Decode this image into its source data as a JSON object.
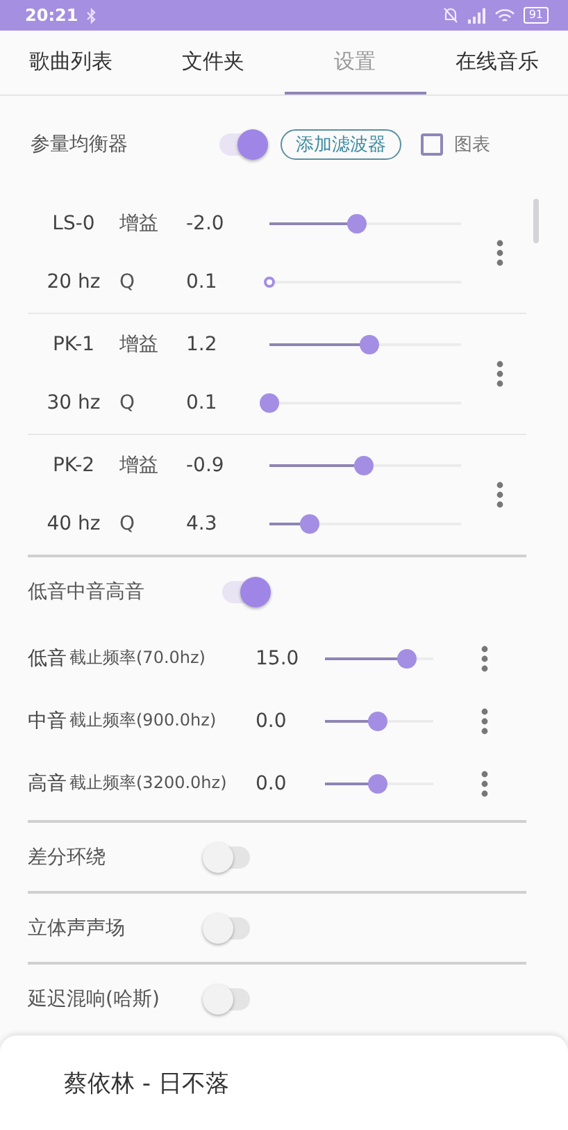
{
  "status_bar": {
    "time": "20:21",
    "battery": "91"
  },
  "tabs": [
    {
      "label": "歌曲列表",
      "selected": false
    },
    {
      "label": "文件夹",
      "selected": false
    },
    {
      "label": "设置",
      "selected": true
    },
    {
      "label": "在线音乐",
      "selected": false
    }
  ],
  "equalizer": {
    "title": "参量均衡器",
    "on": true,
    "add_button": "添加滤波器",
    "chart_label": "图表",
    "chart_checked": false,
    "filters": [
      {
        "name": "LS-0",
        "freq": "20 hz",
        "params": [
          {
            "label": "增益",
            "value": "-2.0",
            "level": 0.46,
            "disabled": false
          },
          {
            "label": "Q",
            "value": "0.1",
            "level": 0,
            "disabled": true
          }
        ]
      },
      {
        "name": "PK-1",
        "freq": "30 hz",
        "params": [
          {
            "label": "增益",
            "value": "1.2",
            "level": 0.52,
            "disabled": false
          },
          {
            "label": "Q",
            "value": "0.1",
            "level": 0,
            "disabled": false
          }
        ]
      },
      {
        "name": "PK-2",
        "freq": "40 hz",
        "params": [
          {
            "label": "增益",
            "value": "-0.9",
            "level": 0.49,
            "disabled": false
          },
          {
            "label": "Q",
            "value": "4.3",
            "level": 0.21,
            "disabled": false
          }
        ]
      }
    ]
  },
  "tone": {
    "title": "低音中音高音",
    "on": true,
    "bands": [
      {
        "name": "低音",
        "cutoff": "截止频率(70.0hz)",
        "value": "15.0",
        "level": 0.75
      },
      {
        "name": "中音",
        "cutoff": "截止频率(900.0hz)",
        "value": "0.0",
        "level": 0.49
      },
      {
        "name": "高音",
        "cutoff": "截止频率(3200.0hz)",
        "value": "0.0",
        "level": 0.49
      }
    ]
  },
  "effects": [
    {
      "label": "差分环绕",
      "on": false
    },
    {
      "label": "立体声声场",
      "on": false
    },
    {
      "label": "延迟混响(哈斯)",
      "on": false
    }
  ],
  "player": {
    "track": "蔡依林 - 日不落"
  }
}
